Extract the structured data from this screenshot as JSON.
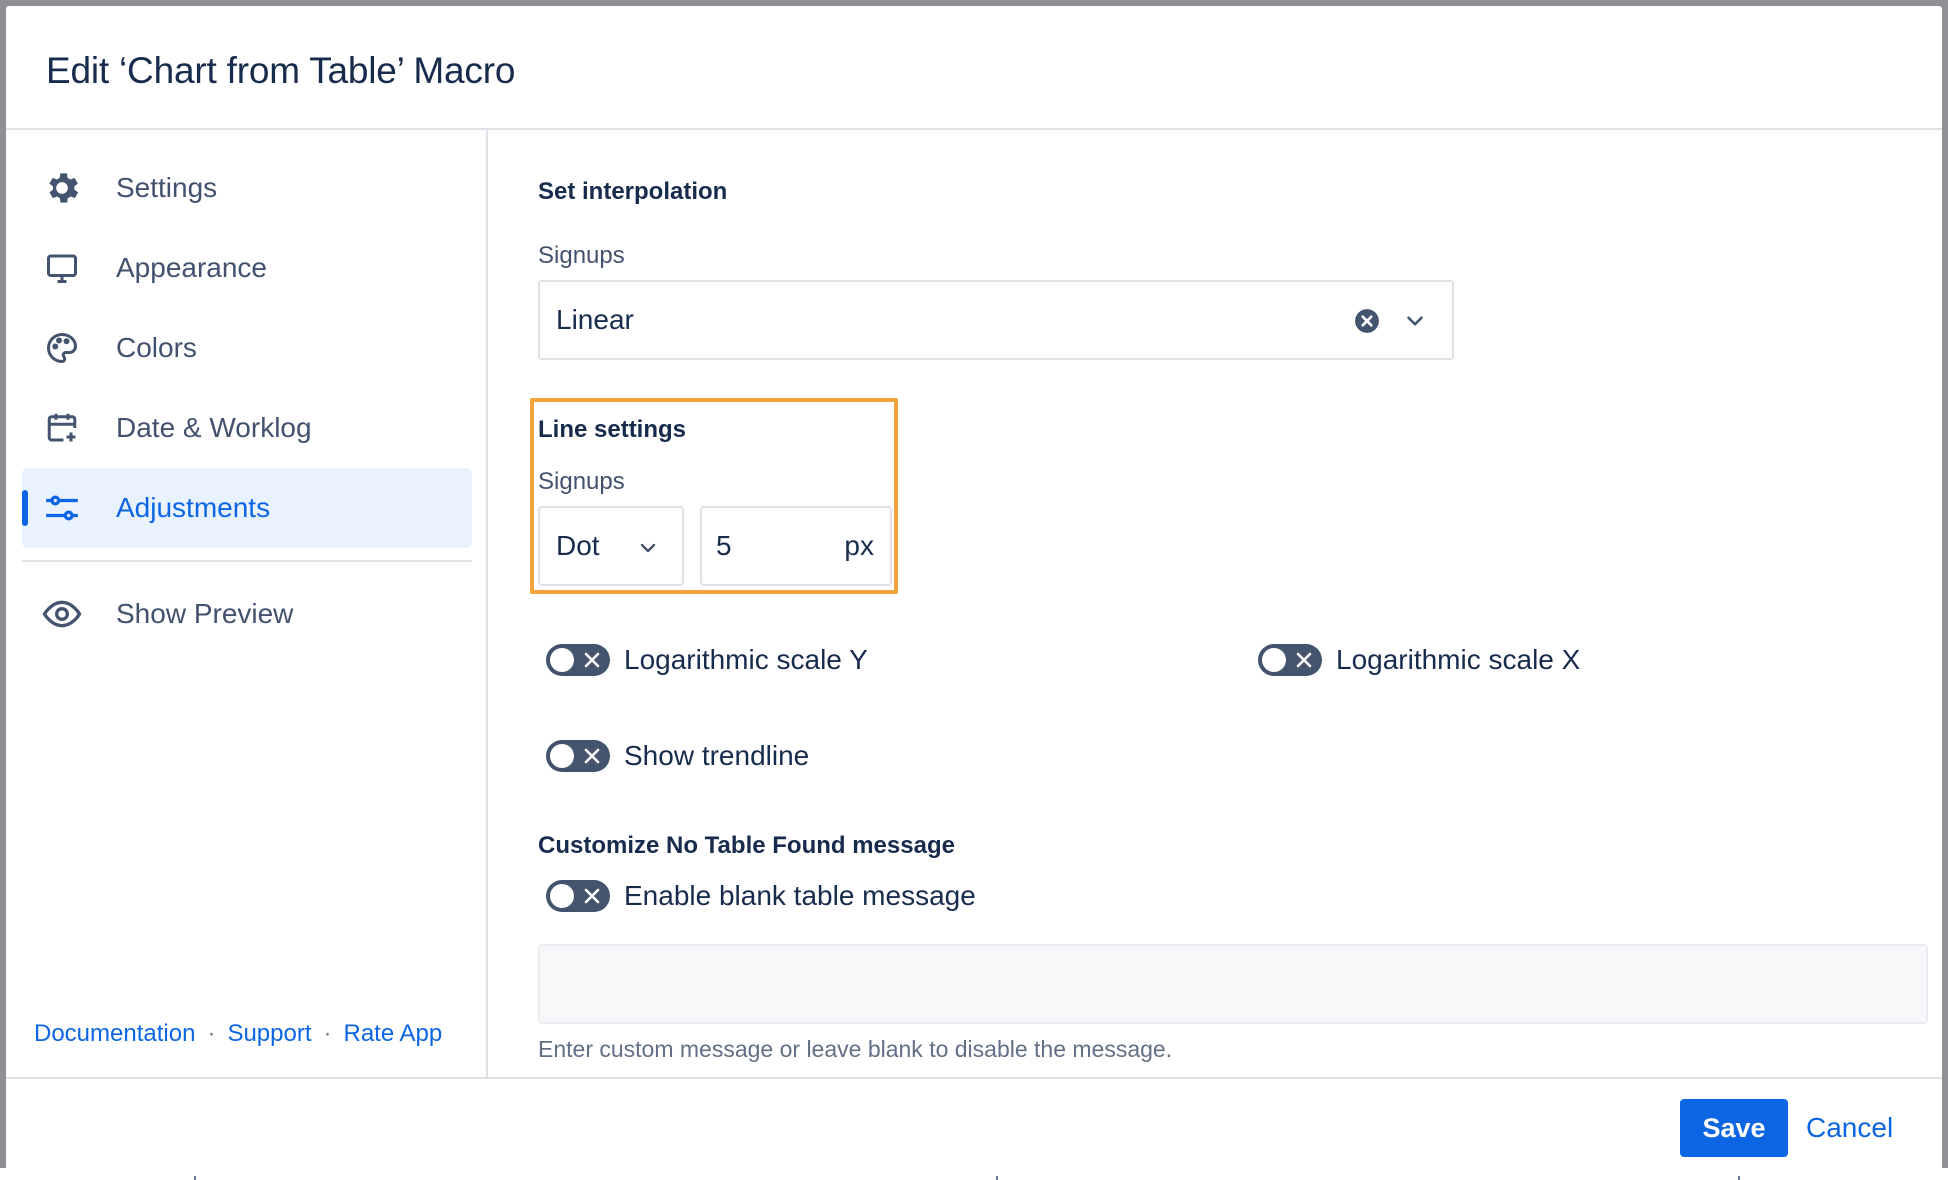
{
  "modal": {
    "title": "Edit ‘Chart from Table’ Macro"
  },
  "sidebar": {
    "items": [
      {
        "label": "Settings",
        "icon": "gear-icon",
        "active": false
      },
      {
        "label": "Appearance",
        "icon": "monitor-icon",
        "active": false
      },
      {
        "label": "Colors",
        "icon": "palette-icon",
        "active": false
      },
      {
        "label": "Date & Worklog",
        "icon": "calendar-add-icon",
        "active": false
      },
      {
        "label": "Adjustments",
        "icon": "sliders-icon",
        "active": true
      }
    ],
    "preview": {
      "label": "Show Preview",
      "icon": "eye-icon"
    },
    "links": {
      "documentation": "Documentation",
      "support": "Support",
      "rate": "Rate App",
      "separator": "·"
    }
  },
  "content": {
    "interpolation": {
      "title": "Set interpolation",
      "label": "Signups",
      "value": "Linear"
    },
    "line_settings": {
      "title": "Line settings",
      "label": "Signups",
      "style_value": "Dot",
      "width_value": "5",
      "width_unit": "px"
    },
    "toggles": {
      "log_y": {
        "label": "Logarithmic scale Y",
        "on": false
      },
      "log_x": {
        "label": "Logarithmic scale X",
        "on": false
      },
      "trendline": {
        "label": "Show trendline",
        "on": false
      },
      "blank_message": {
        "label": "Enable blank table message",
        "on": false
      }
    },
    "no_table": {
      "title": "Customize No Table Found message",
      "message_value": "",
      "helper": "Enter custom message or leave blank to disable the message."
    }
  },
  "footer": {
    "save_label": "Save",
    "cancel_label": "Cancel"
  },
  "colors": {
    "accent": "#0c66e4",
    "highlight": "#f1a33c",
    "toggle_off": "#44546f"
  }
}
